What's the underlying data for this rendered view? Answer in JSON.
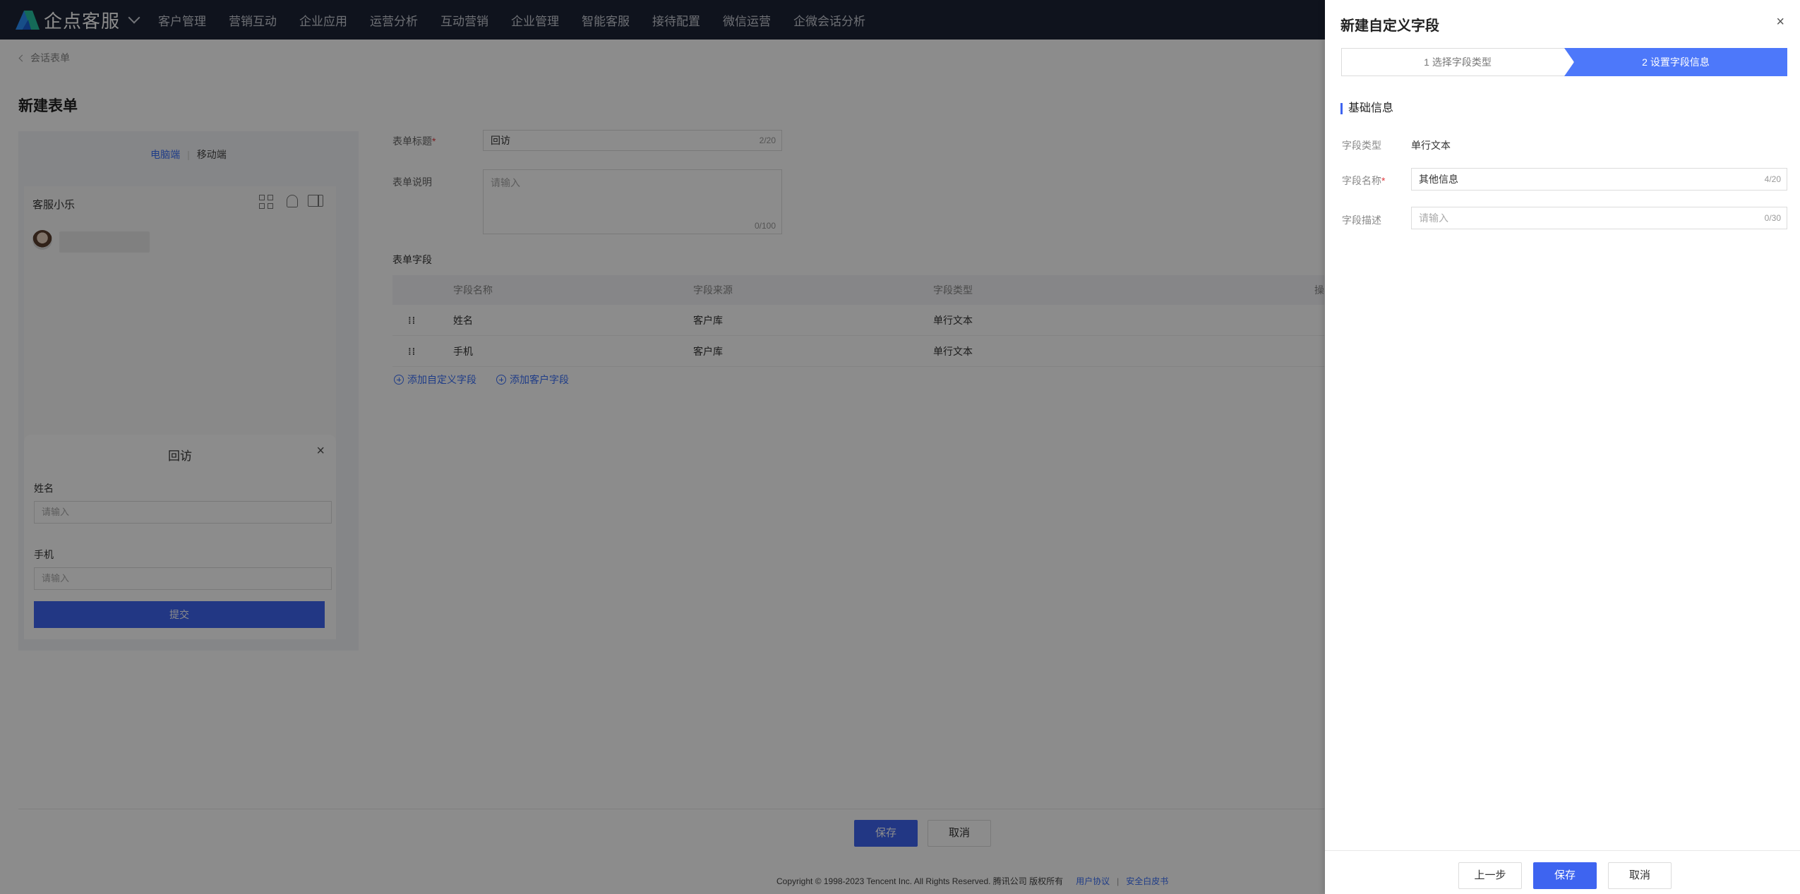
{
  "topnav": {
    "brand": "企点客服",
    "items": [
      {
        "label": "客户管理"
      },
      {
        "label": "营销互动"
      },
      {
        "label": "企业应用"
      },
      {
        "label": "运营分析"
      },
      {
        "label": "互动营销"
      },
      {
        "label": "企业管理"
      },
      {
        "label": "智能客服"
      },
      {
        "label": "接待配置"
      },
      {
        "label": "微信运营"
      },
      {
        "label": "企微会话分析"
      }
    ]
  },
  "page": {
    "breadcrumb": "会话表单",
    "title": "新建表单",
    "preview": {
      "tab_pc": "电脑端",
      "tab_mobile": "移动端",
      "agent_name": "客服小乐",
      "form_title": "回访",
      "close": "×",
      "fields": [
        {
          "label": "姓名",
          "placeholder": "请输入"
        },
        {
          "label": "手机",
          "placeholder": "请输入"
        }
      ],
      "submit": "提交"
    },
    "form": {
      "title_label": "表单标题",
      "title_value": "回访",
      "title_count": "2/20",
      "desc_label": "表单说明",
      "desc_placeholder": "请输入",
      "desc_count": "0/100",
      "fields_label": "表单字段",
      "table": {
        "headers": [
          "字段名称",
          "字段来源",
          "字段类型",
          "操"
        ],
        "rows": [
          {
            "drag": "⁞⁞",
            "name": "姓名",
            "source": "客户库",
            "type": "单行文本"
          },
          {
            "drag": "⁞⁞",
            "name": "手机",
            "source": "客户库",
            "type": "单行文本"
          }
        ]
      },
      "add_custom": "添加自定义字段",
      "add_customer": "添加客户字段"
    },
    "save": "保存",
    "cancel": "取消",
    "footer": {
      "copyright": "Copyright © 1998-2023 Tencent Inc. All Rights Reserved. 腾讯公司 版权所有",
      "agreement": "用户协议",
      "whitepaper": "安全白皮书"
    }
  },
  "drawer": {
    "title": "新建自定义字段",
    "close": "×",
    "step1": "1 选择字段类型",
    "step2": "2 设置字段信息",
    "section": "基础信息",
    "type_label": "字段类型",
    "type_value": "单行文本",
    "name_label": "字段名称",
    "name_value": "其他信息",
    "name_count": "4/20",
    "desc_label": "字段描述",
    "desc_placeholder": "请输入",
    "desc_count": "0/30",
    "prev": "上一步",
    "save": "保存",
    "cancel": "取消"
  },
  "colors": {
    "nav_bg": "#1d2435",
    "primary": "#3e64f0",
    "step_active": "#4d78fa",
    "required": "#e0393e"
  }
}
